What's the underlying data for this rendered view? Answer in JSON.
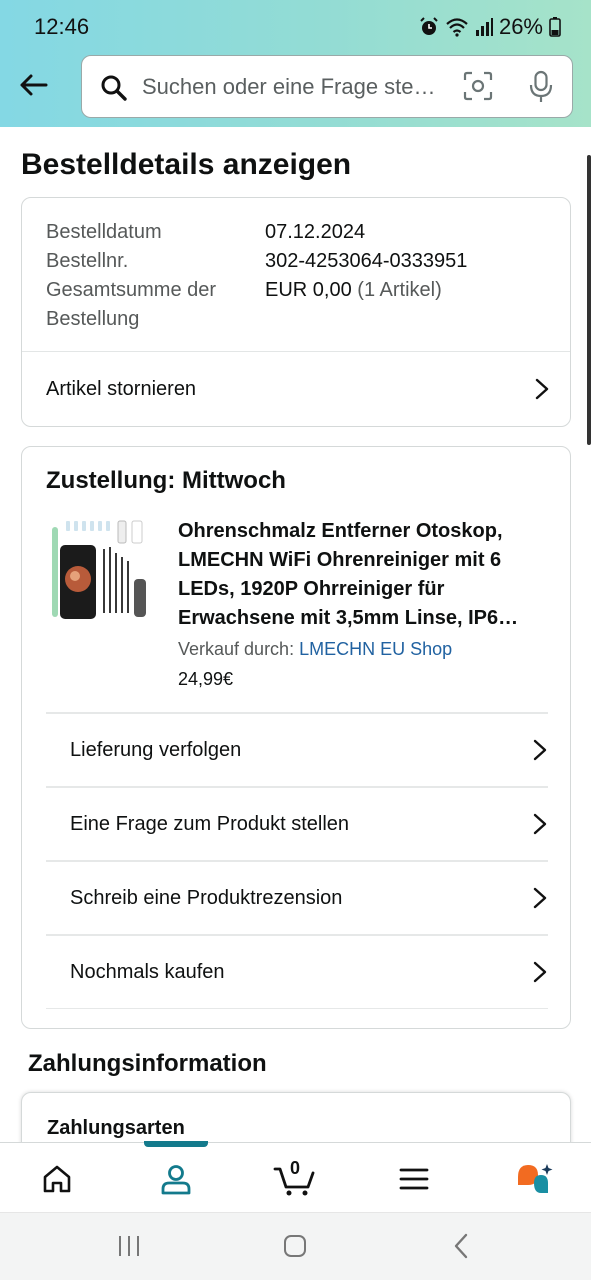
{
  "status": {
    "time": "12:46",
    "battery": "26%"
  },
  "search": {
    "placeholder": "Suchen oder eine Frage ste…"
  },
  "page": {
    "title": "Bestelldetails anzeigen"
  },
  "order_summary": {
    "rows": [
      {
        "label": "Bestelldatum",
        "value": "07.12.2024"
      },
      {
        "label": "Bestellnr.",
        "value": "302-4253064-0333951"
      }
    ],
    "total_label_line1": "Gesamtsumme der",
    "total_label_line2": "Bestellung",
    "total_value": "EUR 0,00",
    "total_items": "(1 Artikel)",
    "cancel_link": "Artikel stornieren"
  },
  "delivery": {
    "heading": "Zustellung: Mittwoch",
    "product": {
      "title": "Ohrenschmalz Entferner Otoskop, LMECHN WiFi Ohrenreiniger mit 6 LEDs, 1920P Ohrreiniger für Erwachsene mit 3,5mm Linse, IP6…",
      "sold_by_label": "Verkauf durch:",
      "seller": "LMECHN EU Shop",
      "price": "24,99€"
    },
    "actions": [
      "Lieferung verfolgen",
      "Eine Frage zum Produkt stellen",
      "Schreib eine Produktrezension",
      "Nochmals kaufen"
    ]
  },
  "payment": {
    "heading": "Zahlungsinformation",
    "methods_label": "Zahlungsarten"
  },
  "tabbar": {
    "cart_count": "0",
    "items": [
      "home-icon",
      "account-icon",
      "cart-icon",
      "menu-icon",
      "ai-assistant-icon"
    ],
    "active": "account-icon",
    "accent": "#137a8c"
  },
  "colors": {
    "link": "#2162a1",
    "text": "#0F1111",
    "muted": "#565959"
  }
}
